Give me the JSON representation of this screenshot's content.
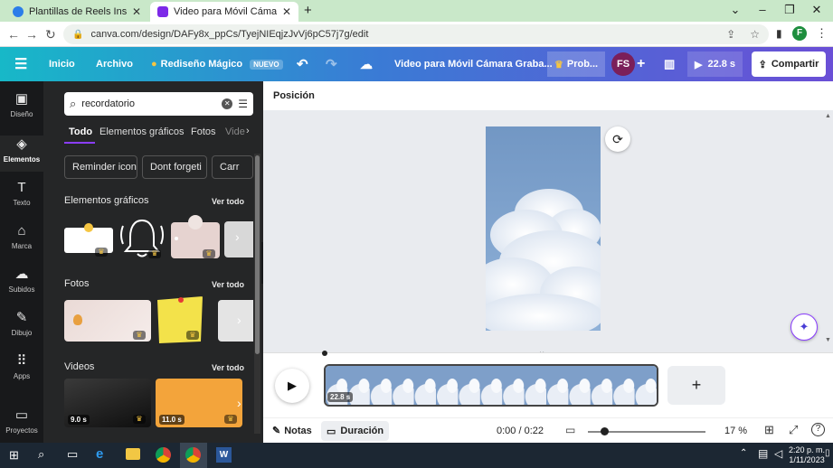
{
  "browser": {
    "tabs": [
      {
        "label": "Plantillas de Reels Instagram | C...",
        "active": false
      },
      {
        "label": "Video para Móvil Cámara Graba...",
        "active": true
      }
    ],
    "new_tab": "+",
    "url": "canva.com/design/DAFy8x_ppCs/TyejNIEqjzJvVj6pC57j7g/edit",
    "profile_initial": "F"
  },
  "topbar": {
    "menu_icon": "hamburger-icon",
    "inicio": "Inicio",
    "archivo": "Archivo",
    "magic": "Rediseño Mágico",
    "magic_badge": "NUEVO",
    "doc_title": "Video para Móvil Cámara Graba...",
    "pro_btn": "Prob...",
    "avatar": "FS",
    "duration": "22.8 s",
    "share": "Compartir"
  },
  "rail": {
    "items": [
      {
        "label": "Diseño",
        "icon": "layout-icon"
      },
      {
        "label": "Elementos",
        "icon": "shapes-icon"
      },
      {
        "label": "Texto",
        "icon": "text-icon"
      },
      {
        "label": "Marca",
        "icon": "brand-icon"
      },
      {
        "label": "Subidos",
        "icon": "upload-icon"
      },
      {
        "label": "Dibujo",
        "icon": "draw-icon"
      },
      {
        "label": "Apps",
        "icon": "apps-icon"
      },
      {
        "label": "Proyectos",
        "icon": "folder-icon"
      }
    ]
  },
  "panel": {
    "search_value": "recordatorio",
    "tabs": [
      "Todo",
      "Elementos gráficos",
      "Fotos",
      "Vide"
    ],
    "chips": [
      "Reminder icon",
      "Dont forgeti",
      "Carr"
    ],
    "sections": {
      "graficos": {
        "title": "Elementos gráficos",
        "see_all": "Ver todo"
      },
      "fotos": {
        "title": "Fotos",
        "see_all": "Ver todo"
      },
      "videos": {
        "title": "Videos",
        "see_all": "Ver todo",
        "durations": [
          "9.0 s",
          "11.0 s"
        ]
      }
    }
  },
  "editor": {
    "position_label": "Posición",
    "clip_duration": "22.8 s",
    "notes": "Notas",
    "duration_btn": "Duración",
    "time": "0:00 / 0:22",
    "zoom": "17 %"
  },
  "taskbar": {
    "time": "2:20 p. m.",
    "date": "1/11/2023"
  },
  "colors": {
    "accent": "#8b3dff",
    "canvas_bg": "#e9ebef",
    "panel_bg": "#252627",
    "rail_bg": "#18191b"
  }
}
